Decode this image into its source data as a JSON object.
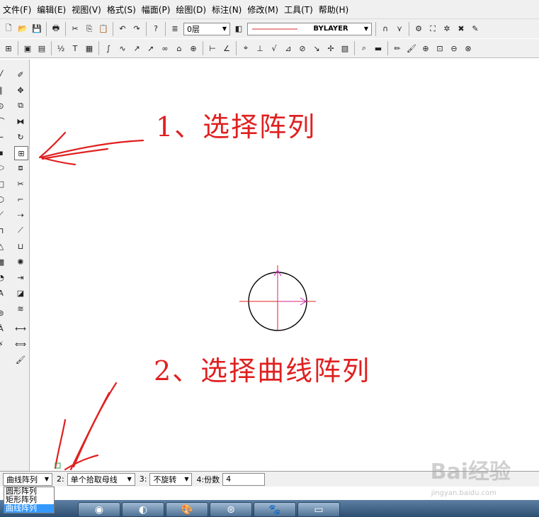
{
  "menu": [
    "文件(F)",
    "编辑(E)",
    "视图(V)",
    "格式(S)",
    "幅面(P)",
    "绘图(D)",
    "标注(N)",
    "修改(M)",
    "工具(T)",
    "帮助(H)"
  ],
  "toolbar": {
    "layer_value": "0层",
    "linetype_value": "BYLAYER",
    "line_color": "#d62828"
  },
  "annotations": {
    "step1": "1、选择阵列",
    "step2": "2、选择曲线阵列",
    "color": "#e02020"
  },
  "statusbar": {
    "array_type": "曲线阵列",
    "field2_label": "2:",
    "field2_value": "单个拾取母线",
    "field3_label": "3:",
    "field3_value": "不旋转",
    "field4_label": "4:份数",
    "field4_value": "4"
  },
  "dropdown": {
    "options": [
      "圆形阵列",
      "矩形阵列",
      "曲线阵列"
    ],
    "selected": "曲线阵列"
  },
  "watermark": {
    "brand": "Bai经验",
    "url": "jingyan.baidu.com"
  }
}
